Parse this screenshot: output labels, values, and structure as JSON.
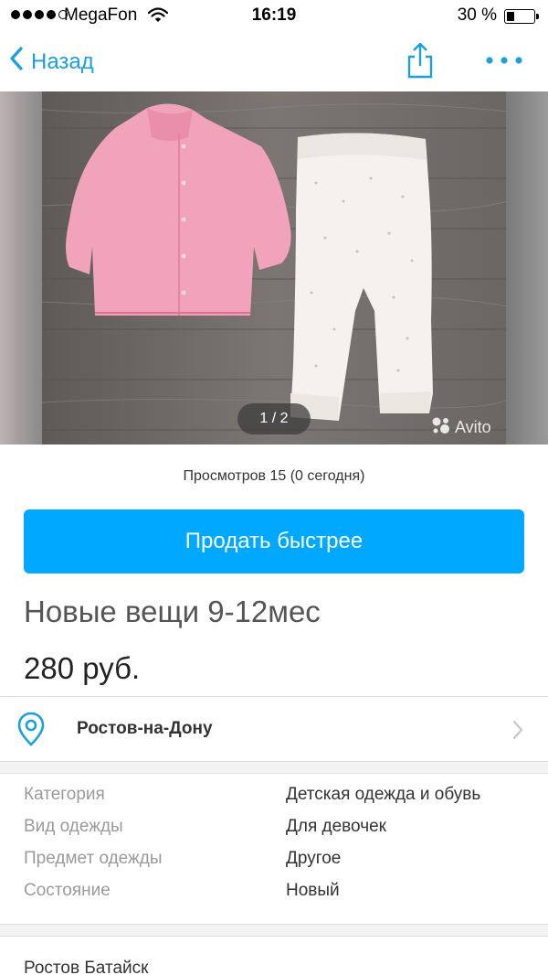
{
  "status_bar": {
    "carrier": "MegaFon",
    "time": "16:19",
    "battery_percent": "30 %",
    "battery_level": 0.3
  },
  "nav": {
    "back_label": "Назад"
  },
  "gallery": {
    "counter": "1 / 2",
    "watermark": "Avito"
  },
  "listing": {
    "views": "Просмотров 15 (0 сегодня)",
    "sell_button": "Продать быстрее",
    "title": "Новые вещи 9-12мес",
    "price": "280 руб.",
    "city": "Ростов-на-Дону",
    "address": "Ростов Батайск"
  },
  "params": [
    {
      "label": "Категория",
      "value": "Детская одежда и обувь"
    },
    {
      "label": "Вид одежды",
      "value": "Для девочек"
    },
    {
      "label": "Предмет одежды",
      "value": "Другое"
    },
    {
      "label": "Состояние",
      "value": "Новый"
    }
  ],
  "colors": {
    "accent": "#00a8ff",
    "link": "#1a9fe0"
  }
}
